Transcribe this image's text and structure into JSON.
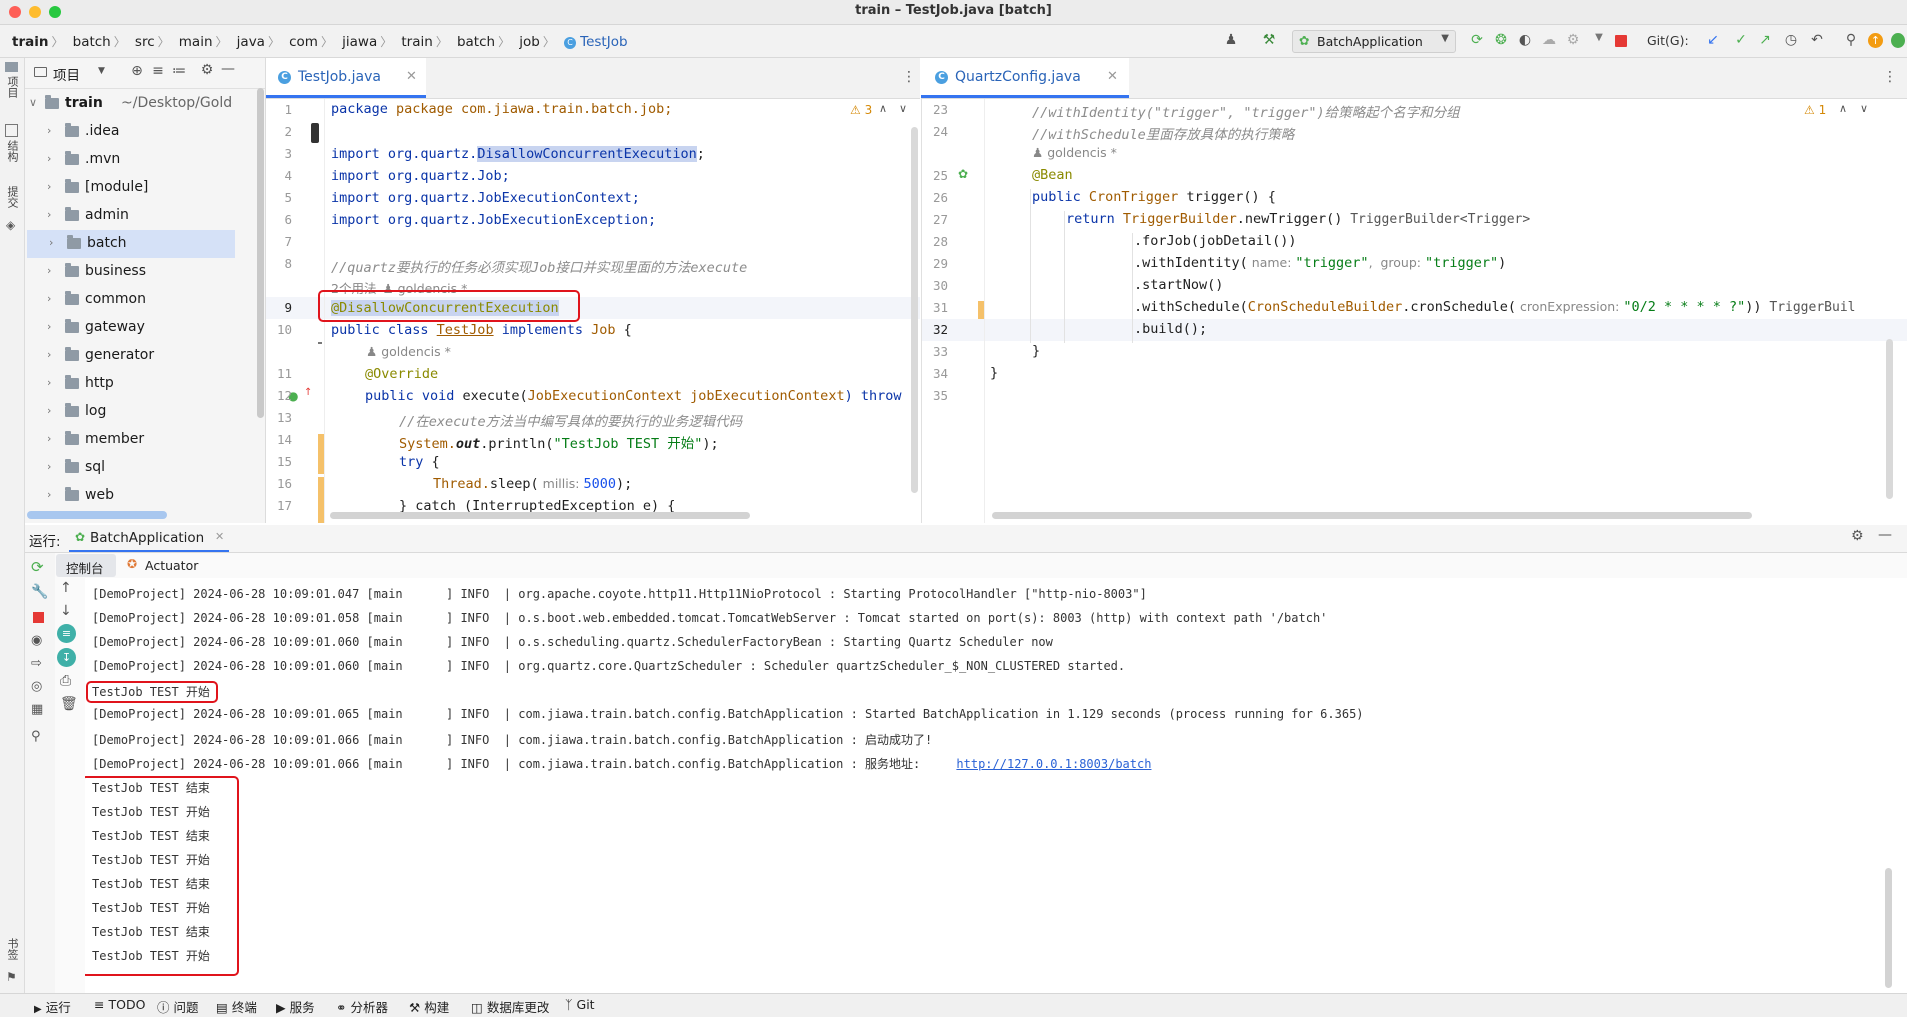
{
  "window": {
    "title": "train – TestJob.java [batch]"
  },
  "breadcrumb": [
    "train",
    "batch",
    "src",
    "main",
    "java",
    "com",
    "jiawa",
    "train",
    "batch",
    "job",
    "TestJob"
  ],
  "toolbar": {
    "run_config": "BatchApplication",
    "git_label": "Git(G):"
  },
  "left_strip": {
    "project": "项目",
    "structure": "结构",
    "commit": "提交",
    "bookmarks": "书签"
  },
  "project_panel": {
    "title": "项目",
    "root": {
      "name": "train",
      "path": "~/Desktop/Golde"
    },
    "items": [
      ".idea",
      ".mvn",
      "[module]",
      "admin",
      "batch",
      "business",
      "common",
      "gateway",
      "generator",
      "http",
      "log",
      "member",
      "sql",
      "web"
    ]
  },
  "editor_left": {
    "tab": "TestJob.java",
    "warnings": "3",
    "line_numbers": [
      "1",
      "2",
      "3",
      "4",
      "5",
      "6",
      "7",
      "8",
      "9",
      "10",
      "11",
      "12",
      "13",
      "14",
      "15",
      "16",
      "17"
    ],
    "usages_hint": "2个用法",
    "author_hint": "goldencis *",
    "lines": {
      "l1": "package com.jiawa.train.batch.job;",
      "l3a": "import org.quartz.",
      "l3b": "DisallowConcurrentExecution",
      "l3c": ";",
      "l4": "import org.quartz.Job;",
      "l5": "import org.quartz.JobExecutionContext;",
      "l6": "import org.quartz.JobExecutionException;",
      "l8": "//quartz要执行的任务必须实现Job接口并实现里面的方法execute",
      "l9": "@DisallowConcurrentExecution",
      "l10a": "public class ",
      "l10b": "TestJob",
      "l10c": " implements ",
      "l10d": "Job",
      "l10e": " {",
      "l11": "@Override",
      "l12a": "public void ",
      "l12b": "execute(",
      "l12c": "JobExecutionContext",
      "l12d": " jobExecutionContext",
      "l12e": ") throw",
      "l13": "//在execute方法当中编写具体的要执行的业务逻辑代码",
      "l14a": "System.",
      "l14b": "out",
      "l14c": ".println(",
      "l14d": "\"TestJob TEST 开始\"",
      "l14e": ");",
      "l15a": "try",
      "l15b": " {",
      "l16a": "Thread.",
      "l16b": "sleep(",
      "l16c": " millis: ",
      "l16d": "5000",
      "l16e": ");",
      "l17": "} catch (InterruptedException e) {"
    }
  },
  "editor_right": {
    "tab": "QuartzConfig.java",
    "warnings": "1",
    "line_numbers": [
      "23",
      "24",
      "25",
      "26",
      "27",
      "28",
      "29",
      "30",
      "31",
      "32",
      "33",
      "34",
      "35"
    ],
    "author_hint": "goldencis *",
    "lines": {
      "l23": "//withIdentity(\"trigger\", \"trigger\")给策略起个名字和分组",
      "l24": "//withSchedule里面存放具体的执行策略",
      "l25": "@Bean",
      "l26a": "public ",
      "l26b": "CronTrigger",
      "l26c": " trigger() {",
      "l27a": "return ",
      "l27b": "TriggerBuilder",
      "l27c": ".newTrigger()",
      "l27d": " TriggerBuilder<Trigger>",
      "l28": ".forJob(jobDetail())",
      "l29a": ".withIdentity(",
      "l29b": " name: ",
      "l29c": "\"trigger\"",
      "l29d": ",  group: ",
      "l29e": "\"trigger\"",
      "l29f": ")",
      "l30": ".startNow()",
      "l31a": ".withSchedule(",
      "l31b": "CronScheduleBuilder",
      "l31c": ".cronSchedule(",
      "l31d": " cronExpression: ",
      "l31e": "\"0/2 * * * * ?\"",
      "l31f": "))",
      "l31g": " TriggerBuil",
      "l32": ".build();",
      "l33": "}",
      "l34": "}"
    }
  },
  "run_panel": {
    "label": "运行:",
    "config_tab": "BatchApplication",
    "tabs": [
      "控制台",
      "Actuator"
    ],
    "logs": [
      "[DemoProject] 2024-06-28 10:09:01.047 [main      ] INFO  | org.apache.coyote.http11.Http11NioProtocol : Starting ProtocolHandler [\"http-nio-8003\"]",
      "[DemoProject] 2024-06-28 10:09:01.058 [main      ] INFO  | o.s.boot.web.embedded.tomcat.TomcatWebServer : Tomcat started on port(s): 8003 (http) with context path '/batch'",
      "[DemoProject] 2024-06-28 10:09:01.060 [main      ] INFO  | o.s.scheduling.quartz.SchedulerFactoryBean : Starting Quartz Scheduler now",
      "[DemoProject] 2024-06-28 10:09:01.060 [main      ] INFO  | org.quartz.core.QuartzScheduler : Scheduler quartzScheduler_$_NON_CLUSTERED started.",
      "TestJob TEST 开始",
      "[DemoProject] 2024-06-28 10:09:01.065 [main      ] INFO  | com.jiawa.train.batch.config.BatchApplication : Started BatchApplication in 1.129 seconds (process running for 6.365)",
      "[DemoProject] 2024-06-28 10:09:01.066 [main      ] INFO  | com.jiawa.train.batch.config.BatchApplication : 启动成功了!",
      "[DemoProject] 2024-06-28 10:09:01.066 [main      ] INFO  | com.jiawa.train.batch.config.BatchApplication : 服务地址:     ",
      "TestJob TEST 结束",
      "TestJob TEST 开始",
      "TestJob TEST 结束",
      "TestJob TEST 开始",
      "TestJob TEST 结束",
      "TestJob TEST 开始",
      "TestJob TEST 结束",
      "TestJob TEST 开始"
    ],
    "service_url": "http://127.0.0.1:8003/batch"
  },
  "status_bar": [
    "运行",
    "TODO",
    "问题",
    "终端",
    "服务",
    "分析器",
    "构建",
    "数据库更改",
    "Git"
  ],
  "colors": {
    "accent": "#3574f0",
    "highlight_box": "#e0141c",
    "stop": "#e53935",
    "run_green": "#4caf50"
  }
}
